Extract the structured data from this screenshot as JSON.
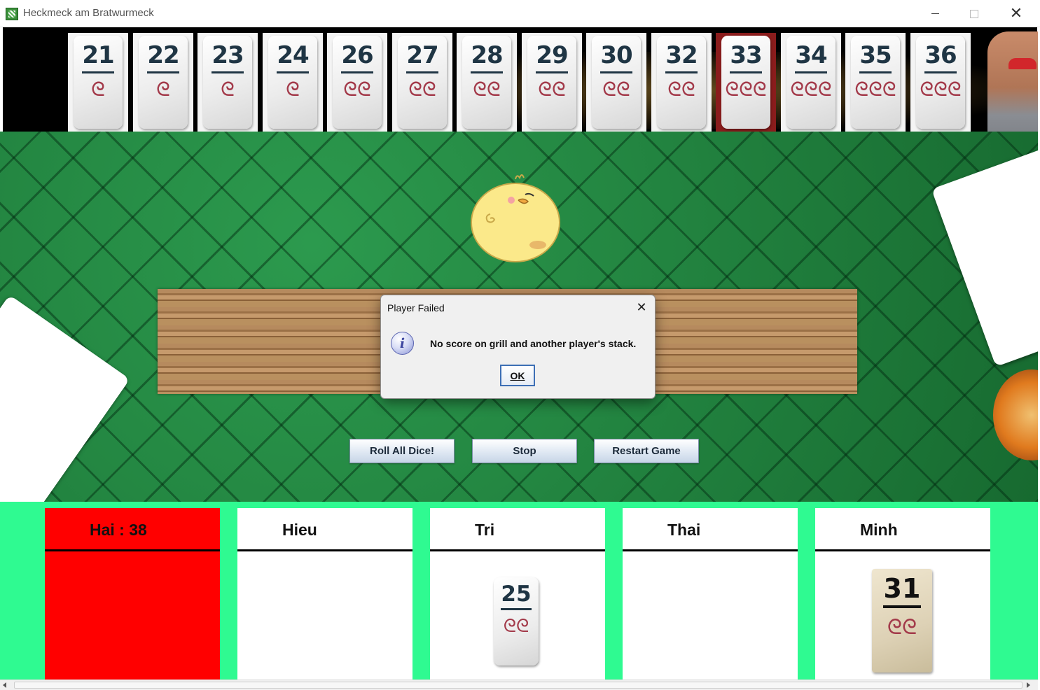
{
  "window": {
    "title": "Heckmeck am Bratwurmeck",
    "close_glyph": "✕"
  },
  "rack": {
    "tiles": [
      {
        "number": "21",
        "worms": "ᘓ"
      },
      {
        "number": "22",
        "worms": "ᘓ"
      },
      {
        "number": "23",
        "worms": "ᘓ"
      },
      {
        "number": "24",
        "worms": "ᘓ"
      },
      {
        "number": "26",
        "worms": "ᘓᘓ"
      },
      {
        "number": "27",
        "worms": "ᘓᘓ"
      },
      {
        "number": "28",
        "worms": "ᘓᘓ"
      },
      {
        "number": "29",
        "worms": "ᘓᘓ"
      },
      {
        "number": "30",
        "worms": "ᘓᘓ"
      },
      {
        "number": "32",
        "worms": "ᘓᘓ"
      },
      {
        "number": "33",
        "worms": "ᘓᘓᘓ"
      },
      {
        "number": "34",
        "worms": "ᘓᘓᘓ"
      },
      {
        "number": "35",
        "worms": "ᘓᘓᘓ"
      },
      {
        "number": "36",
        "worms": "ᘓᘓᘓ"
      }
    ]
  },
  "controls": {
    "roll_label": "Roll All Dice!",
    "stop_label": "Stop",
    "restart_label": "Restart Game"
  },
  "players": [
    {
      "name": "Hai : 38",
      "active": true
    },
    {
      "name": "Hieu"
    },
    {
      "name": "Tri",
      "stack_tile": {
        "number": "25",
        "worms": "ᘓᘓ"
      }
    },
    {
      "name": "Thai"
    },
    {
      "name": "Minh",
      "stack_tile": {
        "number": "31",
        "worms": "ᘓᘓ"
      }
    }
  ],
  "dialog": {
    "title": "Player Failed",
    "message": "No score on grill and another player's stack.",
    "ok_label": "OK",
    "close_glyph": "✕",
    "icon_glyph": "i"
  },
  "colors": {
    "active_player": "#ff0000",
    "players_background": "#2ffa91",
    "taken_tile_background": "#8a1c1c"
  }
}
